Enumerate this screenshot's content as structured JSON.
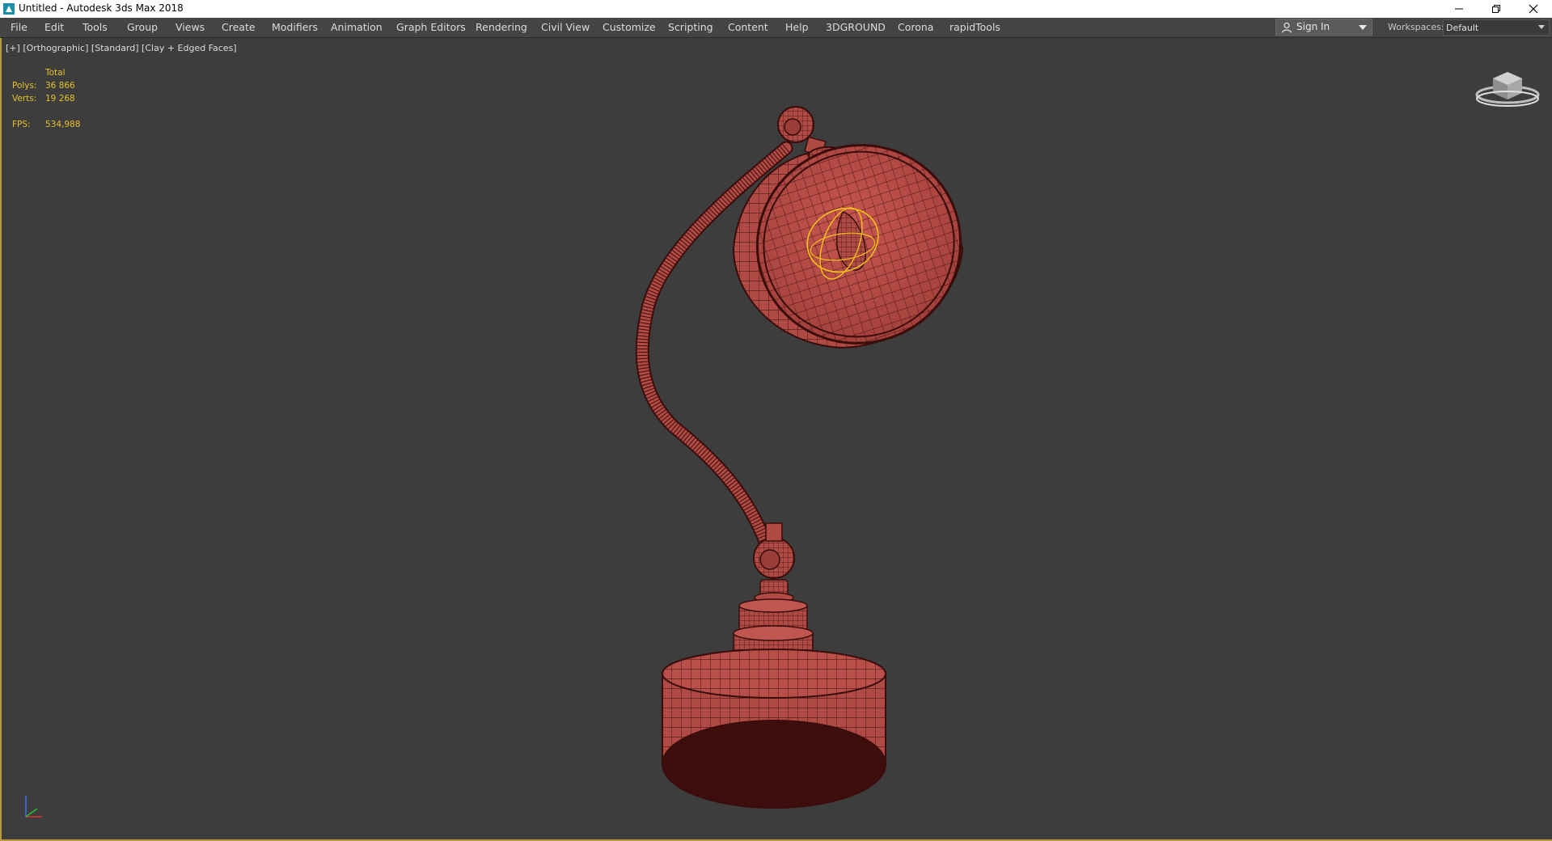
{
  "window": {
    "title": "Untitled - Autodesk 3ds Max 2018"
  },
  "menubar": {
    "items": [
      "File",
      "Edit",
      "Tools",
      "Group",
      "Views",
      "Create",
      "Modifiers",
      "Animation",
      "Graph Editors",
      "Rendering",
      "Civil View",
      "Customize",
      "Scripting",
      "Content",
      "Help",
      "3DGROUND",
      "Corona",
      "rapidTools"
    ]
  },
  "account": {
    "sign_in_label": "Sign In"
  },
  "workspaces": {
    "label": "Workspaces:",
    "value": "Default"
  },
  "viewport": {
    "label_plus": "[+]",
    "label_view": "[Orthographic]",
    "label_shading": "[Standard]",
    "label_style": "[Clay + Edged Faces]",
    "stats": {
      "header": "Total",
      "polys_label": "Polys:",
      "polys_value": "36 866",
      "verts_label": "Verts:",
      "verts_value": "19 268",
      "fps_label": "FPS:",
      "fps_value": "534,988"
    },
    "model_color": "#b04a44",
    "wire_color": "#3a0d0b",
    "selection_color": "#f2c21a"
  },
  "icons": {
    "app": "3dsmax-app-icon",
    "minimize": "minimize-icon",
    "restore": "restore-icon",
    "close": "close-icon",
    "user": "user-icon",
    "viewcube": "viewcube-icon",
    "axis": "axis-tripod-icon"
  }
}
